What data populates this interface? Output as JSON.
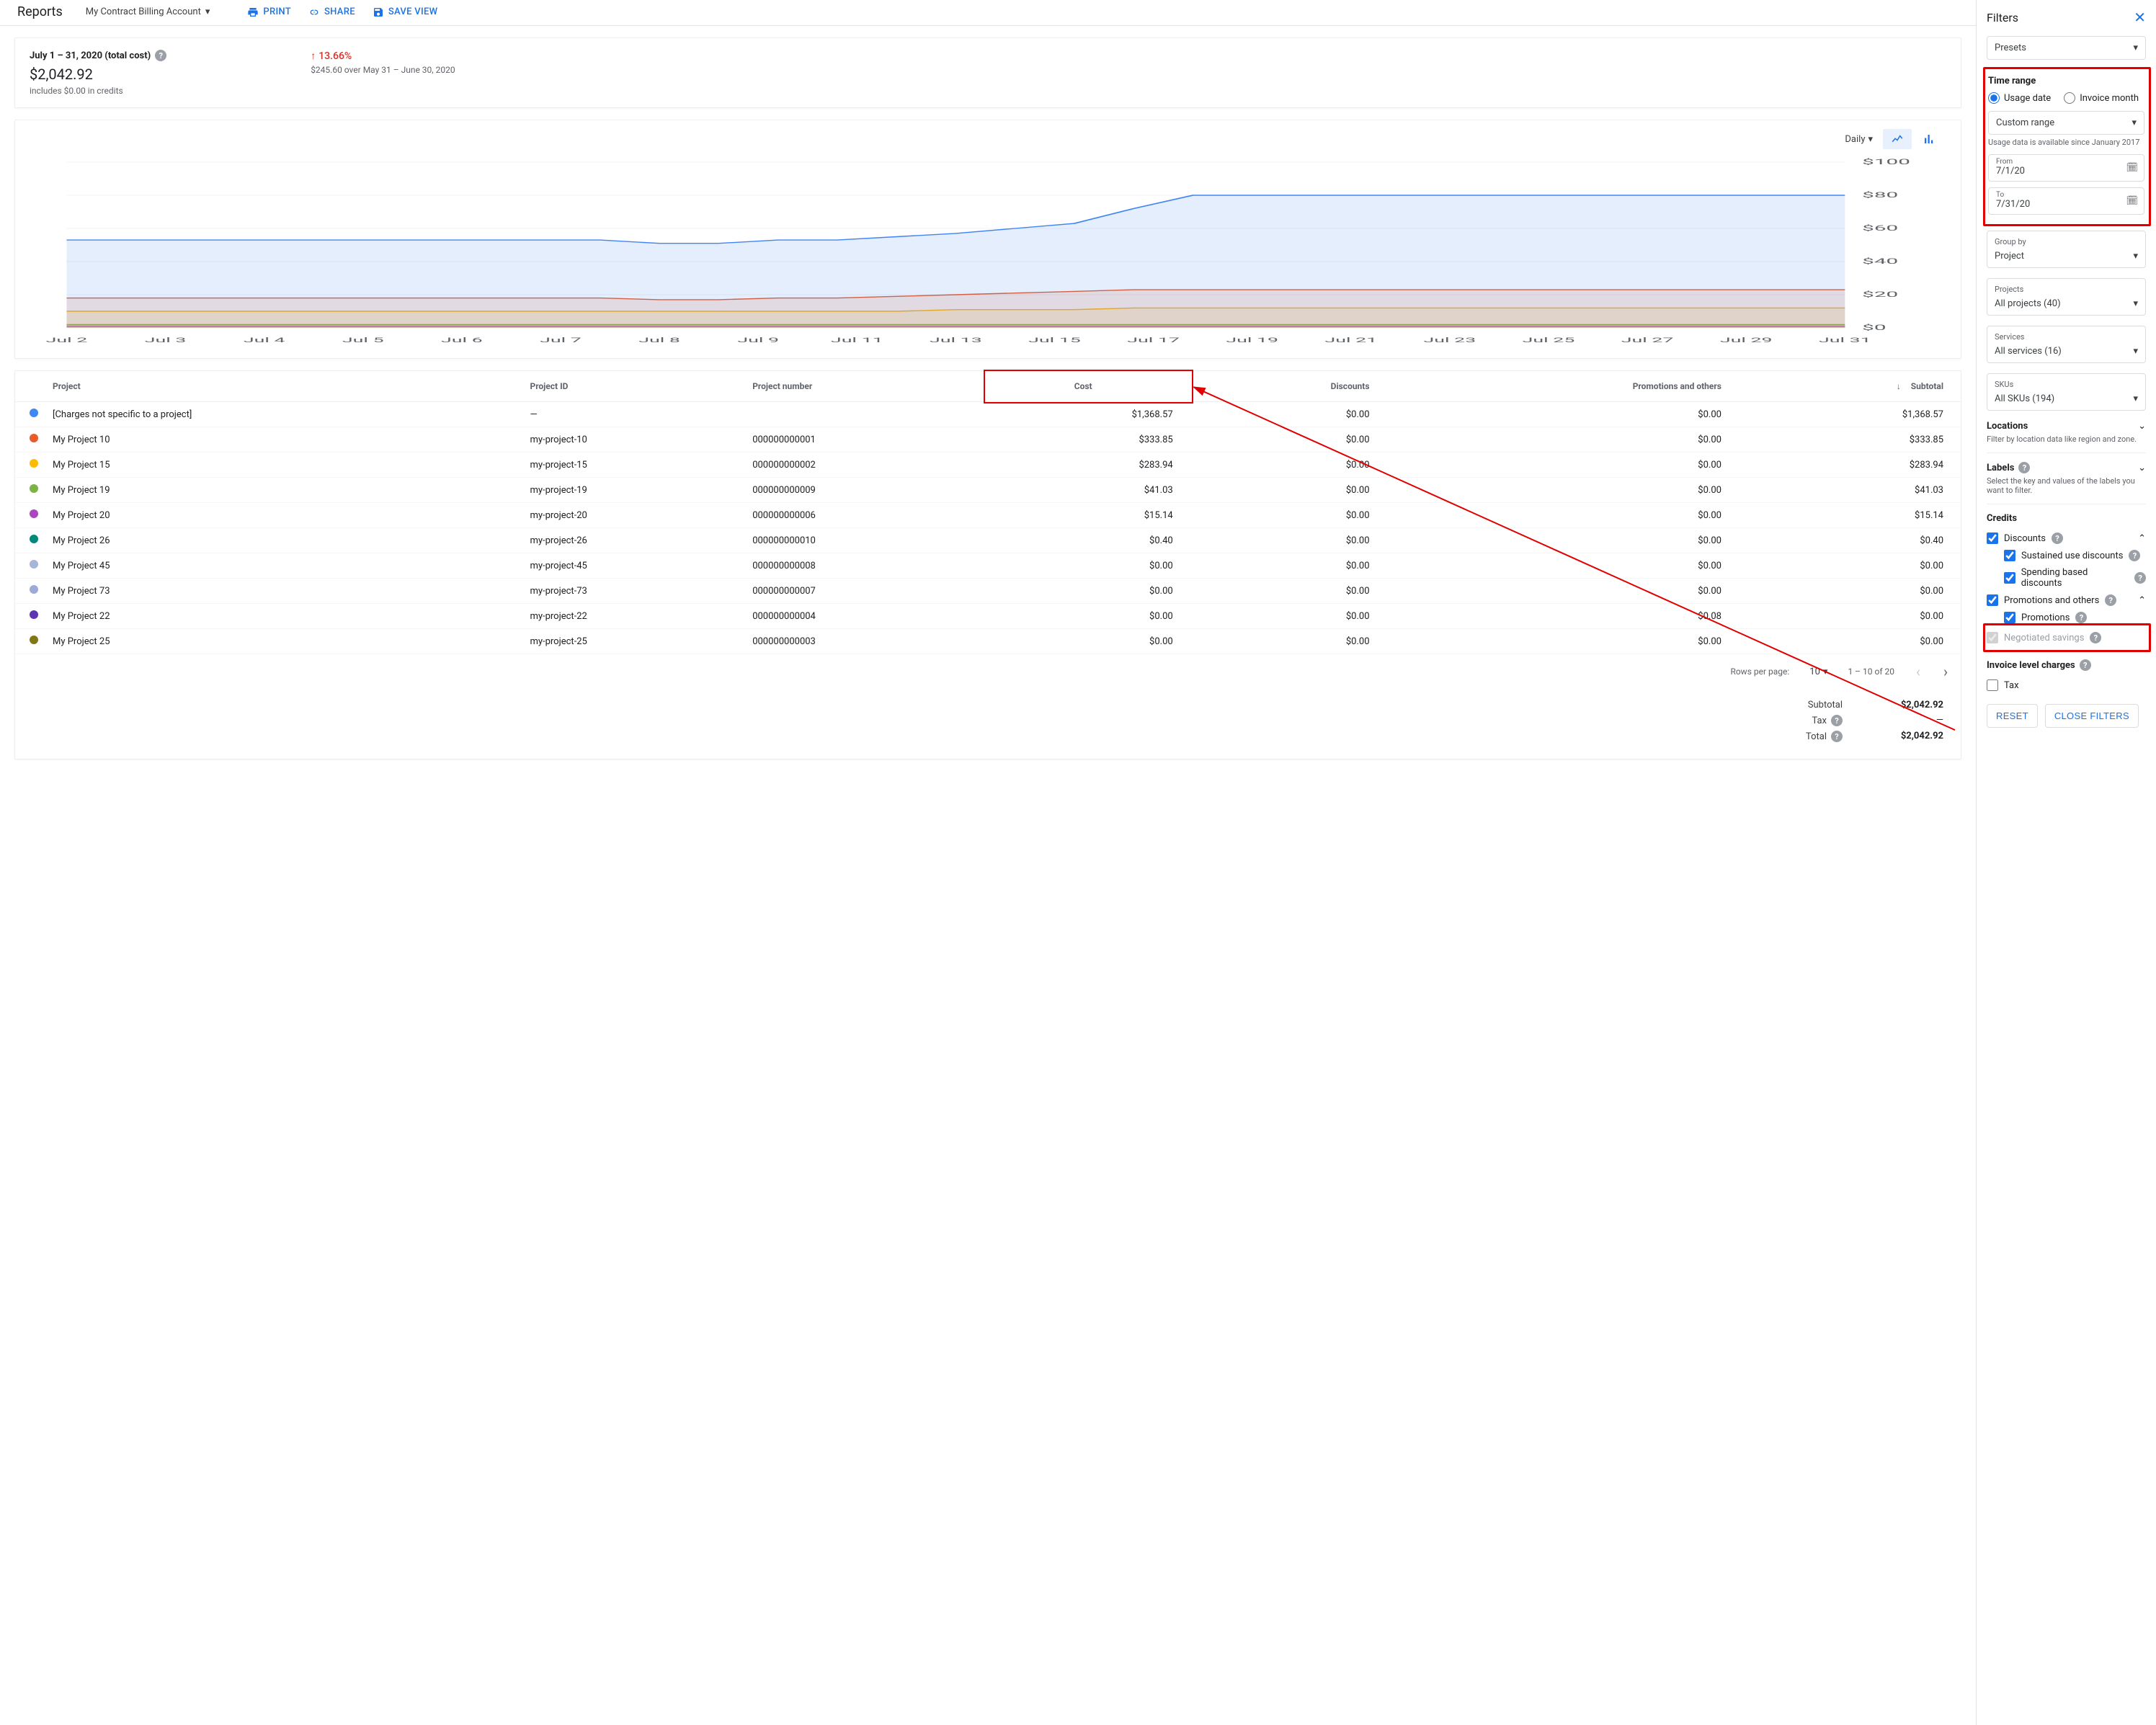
{
  "header": {
    "title": "Reports",
    "account": "My Contract Billing Account",
    "actions": {
      "print": "PRINT",
      "share": "SHARE",
      "save": "SAVE VIEW"
    }
  },
  "summary": {
    "range": "July 1 – 31, 2020 (total cost)",
    "amount": "$2,042.92",
    "credits": "includes $0.00 in credits",
    "pct": "13.66%",
    "delta_line": "$245.60 over May 31 – June 30, 2020"
  },
  "chart": {
    "agg_label": "Daily",
    "ylabels": [
      "$100",
      "$80",
      "$60",
      "$40",
      "$20",
      "$0"
    ],
    "xlabels": [
      "Jul 2",
      "Jul 3",
      "Jul 4",
      "Jul 5",
      "Jul 6",
      "Jul 7",
      "Jul 8",
      "Jul 9",
      "Jul 11",
      "Jul 13",
      "Jul 15",
      "Jul 17",
      "Jul 19",
      "Jul 21",
      "Jul 23",
      "Jul 25",
      "Jul 27",
      "Jul 29",
      "Jul 31"
    ]
  },
  "chart_data": {
    "type": "area",
    "title": "",
    "xlabel": "",
    "ylabel": "",
    "ylim": [
      0,
      100
    ],
    "x": [
      1,
      2,
      3,
      4,
      5,
      6,
      7,
      8,
      9,
      10,
      11,
      12,
      13,
      14,
      15,
      16,
      17,
      18,
      19,
      20,
      21,
      22,
      23,
      24,
      25,
      26,
      27,
      28,
      29,
      30,
      31
    ],
    "series": [
      {
        "name": "[Charges not specific to a project]",
        "color": "#4285f4",
        "values": [
          53,
          53,
          53,
          53,
          53,
          53,
          53,
          53,
          53,
          53,
          51,
          51,
          53,
          53,
          55,
          57,
          60,
          63,
          72,
          80,
          80,
          80,
          80,
          80,
          80,
          80,
          80,
          80,
          80,
          80,
          80
        ]
      },
      {
        "name": "My Project 10",
        "color": "#ea5a2a",
        "values": [
          18,
          18,
          18,
          18,
          18,
          18,
          18,
          18,
          18,
          18,
          17,
          17,
          18,
          18,
          19,
          20,
          21,
          22,
          23,
          23,
          23,
          23,
          23,
          23,
          23,
          23,
          23,
          23,
          23,
          23,
          23
        ]
      },
      {
        "name": "My Project 15",
        "color": "#fbbc04",
        "values": [
          10,
          10,
          10,
          10,
          10,
          10,
          10,
          10,
          10,
          10,
          10,
          10,
          10,
          10,
          10,
          11,
          11,
          11,
          12,
          12,
          12,
          12,
          12,
          12,
          12,
          12,
          12,
          12,
          12,
          12,
          12
        ]
      },
      {
        "name": "My Project 19",
        "color": "#7cb342",
        "values": [
          2,
          2,
          2,
          2,
          2,
          2,
          2,
          2,
          2,
          2,
          2,
          2,
          2,
          2,
          2,
          2,
          2,
          2,
          2,
          2,
          2,
          2,
          2,
          2,
          2,
          2,
          2,
          2,
          2,
          2,
          2
        ]
      },
      {
        "name": "My Project 20",
        "color": "#ab47bc",
        "values": [
          1,
          1,
          1,
          1,
          1,
          1,
          1,
          1,
          1,
          1,
          1,
          1,
          1,
          1,
          1,
          1,
          1,
          1,
          1,
          1,
          1,
          1,
          1,
          1,
          1,
          1,
          1,
          1,
          1,
          1,
          1
        ]
      }
    ]
  },
  "table": {
    "columns": {
      "project": "Project",
      "project_id": "Project ID",
      "project_num": "Project number",
      "cost": "Cost",
      "discounts": "Discounts",
      "promo": "Promotions and others",
      "subtotal": "Subtotal"
    },
    "rows": [
      {
        "color": "#4285f4",
        "name": "[Charges not specific to a project]",
        "id": "—",
        "num": "",
        "cost": "$1,368.57",
        "disc": "$0.00",
        "promo": "$0.00",
        "sub": "$1,368.57"
      },
      {
        "color": "#ea5a2a",
        "name": "My Project 10",
        "id": "my-project-10",
        "num": "000000000001",
        "cost": "$333.85",
        "disc": "$0.00",
        "promo": "$0.00",
        "sub": "$333.85"
      },
      {
        "color": "#fbbc04",
        "name": "My Project 15",
        "id": "my-project-15",
        "num": "000000000002",
        "cost": "$283.94",
        "disc": "$0.00",
        "promo": "$0.00",
        "sub": "$283.94"
      },
      {
        "color": "#7cb342",
        "name": "My Project 19",
        "id": "my-project-19",
        "num": "000000000009",
        "cost": "$41.03",
        "disc": "$0.00",
        "promo": "$0.00",
        "sub": "$41.03"
      },
      {
        "color": "#ab47bc",
        "name": "My Project 20",
        "id": "my-project-20",
        "num": "000000000006",
        "cost": "$15.14",
        "disc": "$0.00",
        "promo": "$0.00",
        "sub": "$15.14"
      },
      {
        "color": "#00897b",
        "name": "My Project 26",
        "id": "my-project-26",
        "num": "000000000010",
        "cost": "$0.40",
        "disc": "$0.00",
        "promo": "$0.00",
        "sub": "$0.40"
      },
      {
        "color": "#a7b5d6",
        "name": "My Project 45",
        "id": "my-project-45",
        "num": "000000000008",
        "cost": "$0.00",
        "disc": "$0.00",
        "promo": "$0.00",
        "sub": "$0.00"
      },
      {
        "color": "#9fa8da",
        "name": "My Project 73",
        "id": "my-project-73",
        "num": "000000000007",
        "cost": "$0.00",
        "disc": "$0.00",
        "promo": "$0.00",
        "sub": "$0.00"
      },
      {
        "color": "#5e35b1",
        "name": "My Project 22",
        "id": "my-project-22",
        "num": "000000000004",
        "cost": "$0.00",
        "disc": "$0.00",
        "promo": "$0.08",
        "sub": "$0.00"
      },
      {
        "color": "#827717",
        "name": "My Project 25",
        "id": "my-project-25",
        "num": "000000000003",
        "cost": "$0.00",
        "disc": "$0.00",
        "promo": "$0.00",
        "sub": "$0.00"
      }
    ]
  },
  "pager": {
    "rows_label": "Rows per page:",
    "rows": "10",
    "range": "1 – 10 of 20"
  },
  "totals": {
    "subtotal_l": "Subtotal",
    "subtotal_v": "$2,042.92",
    "tax_l": "Tax",
    "tax_v": "—",
    "total_l": "Total",
    "total_v": "$2,042.92"
  },
  "filters": {
    "title": "Filters",
    "presets": "Presets",
    "time_range": "Time range",
    "usage_date": "Usage date",
    "invoice_month": "Invoice month",
    "custom_range": "Custom range",
    "hint": "Usage data is available since January 2017",
    "from_l": "From",
    "from_v": "7/1/20",
    "to_l": "To",
    "to_v": "7/31/20",
    "group_by_l": "Group by",
    "group_by_v": "Project",
    "projects_l": "Projects",
    "projects_v": "All projects (40)",
    "services_l": "Services",
    "services_v": "All services (16)",
    "skus_l": "SKUs",
    "skus_v": "All SKUs (194)",
    "locations_l": "Locations",
    "locations_hint": "Filter by location data like region and zone.",
    "labels_l": "Labels",
    "labels_hint": "Select the key and values of the labels you want to filter.",
    "credits_l": "Credits",
    "discounts": "Discounts",
    "sud": "Sustained use discounts",
    "sbd": "Spending based discounts",
    "promo": "Promotions and others",
    "promotions": "Promotions",
    "neg": "Negotiated savings",
    "ilc": "Invoice level charges",
    "tax": "Tax",
    "reset": "RESET",
    "close": "CLOSE FILTERS"
  }
}
